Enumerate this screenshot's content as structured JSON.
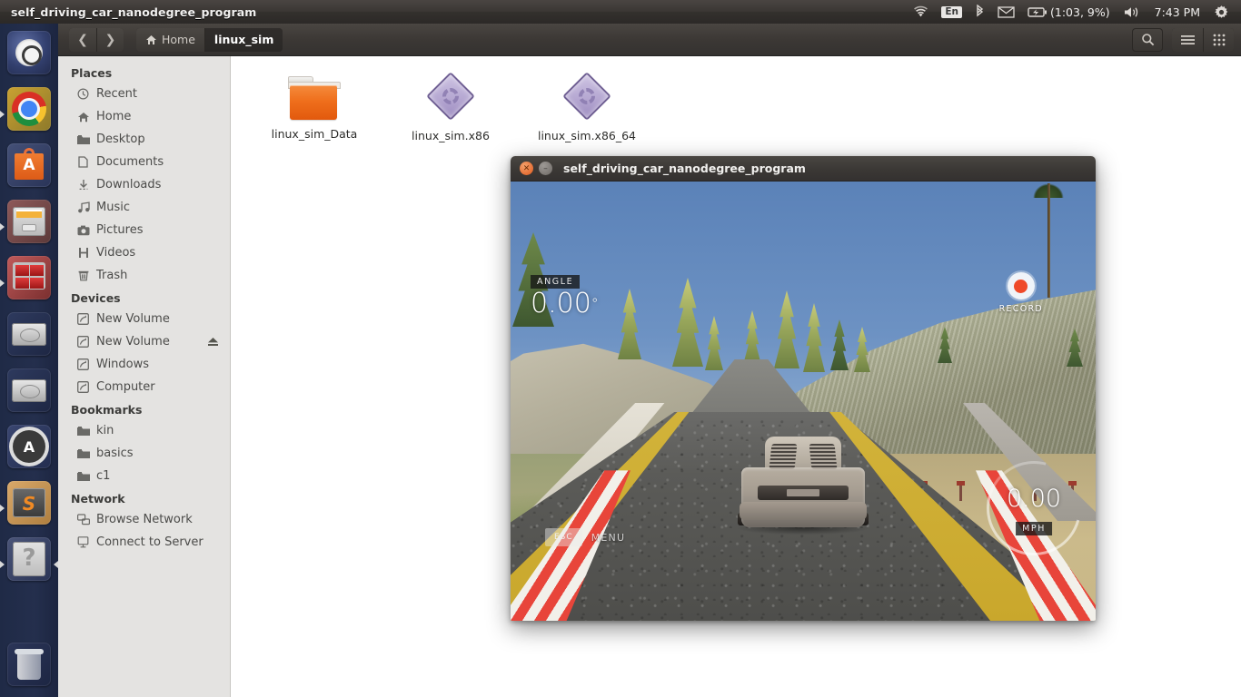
{
  "top_panel": {
    "window_title": "self_driving_car_nanodegree_program",
    "tray": {
      "wifi_icon": "wifi-icon",
      "keyboard_layout": "En",
      "bluetooth_icon": "bluetooth-icon",
      "mail_icon": "mail-icon",
      "battery_icon": "battery-icon",
      "battery_text": "(1:03, 9%)",
      "volume_icon": "volume-icon",
      "clock": "7:43 PM",
      "session_icon": "gear-session-icon"
    }
  },
  "launcher": {
    "items": [
      {
        "name": "ubuntu-dash",
        "icon": "ubuntu-logo-icon",
        "running": false
      },
      {
        "name": "google-chrome",
        "icon": "chrome-icon",
        "running": true
      },
      {
        "name": "ubuntu-software",
        "icon": "software-center-icon",
        "running": false
      },
      {
        "name": "files",
        "icon": "file-manager-icon",
        "running": true
      },
      {
        "name": "vlc-media-player",
        "icon": "media-player-icon",
        "running": true
      },
      {
        "name": "disk-volume-1",
        "icon": "hard-disk-icon",
        "running": false
      },
      {
        "name": "disk-volume-2",
        "icon": "hard-disk-icon",
        "running": false
      },
      {
        "name": "software-updater",
        "icon": "software-updater-icon",
        "running": false
      },
      {
        "name": "sublime-text",
        "icon": "sublime-text-icon",
        "running": true
      },
      {
        "name": "help",
        "icon": "help-icon",
        "running": true
      },
      {
        "name": "trash",
        "icon": "trash-icon",
        "running": false
      }
    ]
  },
  "file_manager": {
    "nav": {
      "back_icon": "chevron-left-icon",
      "forward_icon": "chevron-right-icon"
    },
    "breadcrumbs": [
      {
        "label": "Home",
        "icon": "home-icon",
        "active": false
      },
      {
        "label": "linux_sim",
        "icon": "",
        "active": true
      }
    ],
    "toolbar": {
      "search_icon": "search-icon",
      "list_view_icon": "list-view-icon",
      "grid_view_icon": "grid-view-icon"
    },
    "sidebar": {
      "groups": [
        {
          "title": "Places",
          "items": [
            {
              "label": "Recent",
              "icon": "clock-icon"
            },
            {
              "label": "Home",
              "icon": "home-icon"
            },
            {
              "label": "Desktop",
              "icon": "desktop-folder-icon"
            },
            {
              "label": "Documents",
              "icon": "document-icon"
            },
            {
              "label": "Downloads",
              "icon": "download-icon"
            },
            {
              "label": "Music",
              "icon": "music-note-icon"
            },
            {
              "label": "Pictures",
              "icon": "camera-icon"
            },
            {
              "label": "Videos",
              "icon": "film-icon"
            },
            {
              "label": "Trash",
              "icon": "trash-icon"
            }
          ]
        },
        {
          "title": "Devices",
          "items": [
            {
              "label": "New Volume",
              "icon": "drive-icon"
            },
            {
              "label": "New Volume",
              "icon": "drive-icon",
              "eject": "eject-icon"
            },
            {
              "label": "Windows",
              "icon": "drive-icon"
            },
            {
              "label": "Computer",
              "icon": "drive-icon"
            }
          ]
        },
        {
          "title": "Bookmarks",
          "items": [
            {
              "label": "kin",
              "icon": "folder-icon"
            },
            {
              "label": "basics",
              "icon": "folder-icon"
            },
            {
              "label": "c1",
              "icon": "folder-icon"
            }
          ]
        },
        {
          "title": "Network",
          "items": [
            {
              "label": "Browse Network",
              "icon": "network-icon"
            },
            {
              "label": "Connect to Server",
              "icon": "server-icon"
            }
          ]
        }
      ]
    },
    "files": [
      {
        "name": "linux_sim_Data",
        "icon": "folder-icon",
        "type": "folder"
      },
      {
        "name": "linux_sim.x86",
        "icon": "executable-icon",
        "type": "executable"
      },
      {
        "name": "linux_sim.x86_64",
        "icon": "executable-icon",
        "type": "executable"
      }
    ]
  },
  "simulator": {
    "title": "self_driving_car_nanodegree_program",
    "close_icon": "close-icon",
    "minimize_icon": "minimize-icon",
    "hud": {
      "angle_label": "ANGLE",
      "angle_value": "0.00",
      "angle_unit": "°",
      "record_label": "RECORD",
      "record_icon": "record-dot-icon",
      "speed_value": "0.00",
      "speed_label": "MPH",
      "esc_label": "ESC",
      "menu_label": "MENU"
    }
  },
  "colors": {
    "panel": "#3b3835",
    "launcher": "#212b49",
    "sidebar": "#e4e3e1",
    "accent_orange": "#ef6f1c",
    "record_red": "#ef4a2a",
    "sky": "#6d92c3"
  }
}
